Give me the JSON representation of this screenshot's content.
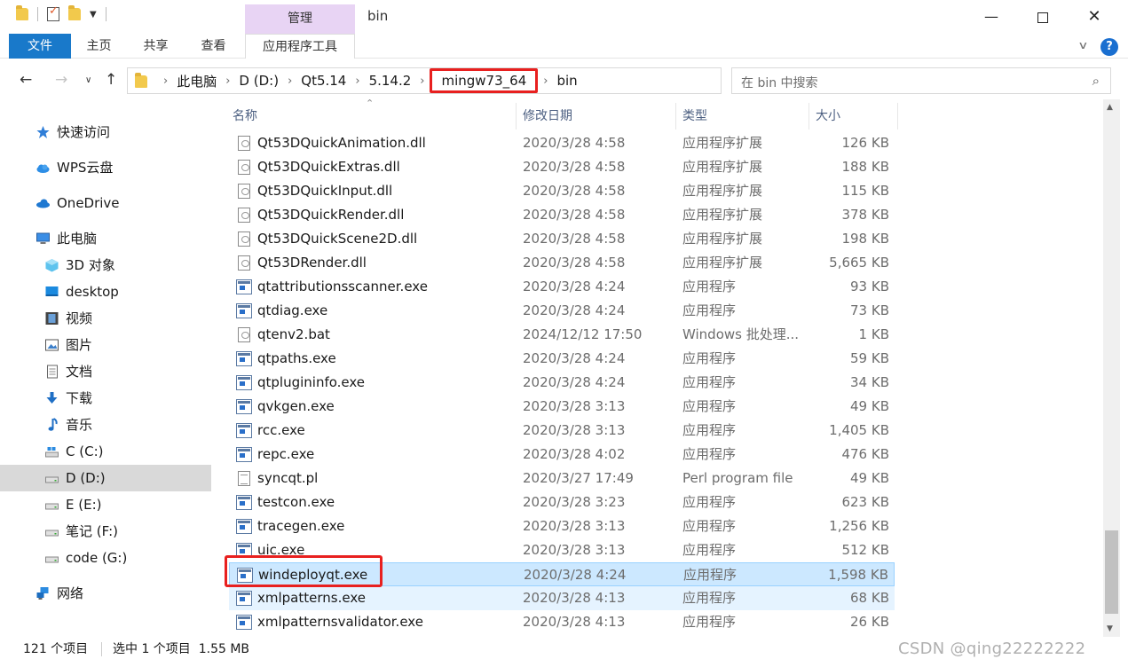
{
  "window": {
    "title": "bin",
    "context_tab_header": "管理",
    "buttons": {
      "minimize": "—",
      "maximize": "",
      "close": "✕"
    }
  },
  "ribbon": {
    "tabs": [
      "文件",
      "主页",
      "共享",
      "查看",
      "应用程序工具"
    ],
    "active_tab": "文件",
    "help": "?"
  },
  "address": {
    "crumbs": [
      "此电脑",
      "D (D:)",
      "Qt5.14",
      "5.14.2",
      "mingw73_64",
      "bin"
    ],
    "highlighted_crumb": "mingw73_64"
  },
  "search": {
    "placeholder": "在 bin 中搜索"
  },
  "nav_pane": {
    "items": [
      {
        "label": "快速访问",
        "icon": "star-icon"
      },
      {
        "label": "WPS云盘",
        "icon": "cloud-icon"
      },
      {
        "label": "OneDrive",
        "icon": "onedrive-icon"
      },
      {
        "label": "此电脑",
        "icon": "computer-icon"
      },
      {
        "label": "3D 对象",
        "icon": "cube-icon"
      },
      {
        "label": "desktop",
        "icon": "desktop-icon"
      },
      {
        "label": "视频",
        "icon": "video-icon"
      },
      {
        "label": "图片",
        "icon": "picture-icon"
      },
      {
        "label": "文档",
        "icon": "document-icon"
      },
      {
        "label": "下载",
        "icon": "download-icon"
      },
      {
        "label": "音乐",
        "icon": "music-icon"
      },
      {
        "label": "C (C:)",
        "icon": "drive-c-icon"
      },
      {
        "label": "D (D:)",
        "icon": "drive-icon"
      },
      {
        "label": "E (E:)",
        "icon": "drive-icon"
      },
      {
        "label": "笔记 (F:)",
        "icon": "drive-icon"
      },
      {
        "label": "code (G:)",
        "icon": "drive-icon"
      },
      {
        "label": "网络",
        "icon": "network-icon"
      }
    ],
    "selected": "D (D:)"
  },
  "columns": [
    "名称",
    "修改日期",
    "类型",
    "大小"
  ],
  "files": [
    {
      "name": "Qt53DQuickAnimation.dll",
      "date": "2020/3/28 4:58",
      "type": "应用程序扩展",
      "size": "126 KB",
      "icon": "dll"
    },
    {
      "name": "Qt53DQuickExtras.dll",
      "date": "2020/3/28 4:58",
      "type": "应用程序扩展",
      "size": "188 KB",
      "icon": "dll"
    },
    {
      "name": "Qt53DQuickInput.dll",
      "date": "2020/3/28 4:58",
      "type": "应用程序扩展",
      "size": "115 KB",
      "icon": "dll"
    },
    {
      "name": "Qt53DQuickRender.dll",
      "date": "2020/3/28 4:58",
      "type": "应用程序扩展",
      "size": "378 KB",
      "icon": "dll"
    },
    {
      "name": "Qt53DQuickScene2D.dll",
      "date": "2020/3/28 4:58",
      "type": "应用程序扩展",
      "size": "198 KB",
      "icon": "dll"
    },
    {
      "name": "Qt53DRender.dll",
      "date": "2020/3/28 4:58",
      "type": "应用程序扩展",
      "size": "5,665 KB",
      "icon": "dll"
    },
    {
      "name": "qtattributionsscanner.exe",
      "date": "2020/3/28 4:24",
      "type": "应用程序",
      "size": "93 KB",
      "icon": "exe"
    },
    {
      "name": "qtdiag.exe",
      "date": "2020/3/28 4:24",
      "type": "应用程序",
      "size": "73 KB",
      "icon": "exe"
    },
    {
      "name": "qtenv2.bat",
      "date": "2024/12/12 17:50",
      "type": "Windows 批处理...",
      "size": "1 KB",
      "icon": "bat"
    },
    {
      "name": "qtpaths.exe",
      "date": "2020/3/28 4:24",
      "type": "应用程序",
      "size": "59 KB",
      "icon": "exe"
    },
    {
      "name": "qtplugininfo.exe",
      "date": "2020/3/28 4:24",
      "type": "应用程序",
      "size": "34 KB",
      "icon": "exe"
    },
    {
      "name": "qvkgen.exe",
      "date": "2020/3/28 3:13",
      "type": "应用程序",
      "size": "49 KB",
      "icon": "exe"
    },
    {
      "name": "rcc.exe",
      "date": "2020/3/28 3:13",
      "type": "应用程序",
      "size": "1,405 KB",
      "icon": "exe"
    },
    {
      "name": "repc.exe",
      "date": "2020/3/28 4:02",
      "type": "应用程序",
      "size": "476 KB",
      "icon": "exe"
    },
    {
      "name": "syncqt.pl",
      "date": "2020/3/27 17:49",
      "type": "Perl program file",
      "size": "49 KB",
      "icon": "txt"
    },
    {
      "name": "testcon.exe",
      "date": "2020/3/28 3:23",
      "type": "应用程序",
      "size": "623 KB",
      "icon": "exe"
    },
    {
      "name": "tracegen.exe",
      "date": "2020/3/28 3:13",
      "type": "应用程序",
      "size": "1,256 KB",
      "icon": "exe"
    },
    {
      "name": "uic.exe",
      "date": "2020/3/28 3:13",
      "type": "应用程序",
      "size": "512 KB",
      "icon": "exe"
    },
    {
      "name": "windeployqt.exe",
      "date": "2020/3/28 4:24",
      "type": "应用程序",
      "size": "1,598 KB",
      "icon": "exe",
      "state": "selected"
    },
    {
      "name": "xmlpatterns.exe",
      "date": "2020/3/28 4:13",
      "type": "应用程序",
      "size": "68 KB",
      "icon": "exe",
      "state": "hover"
    },
    {
      "name": "xmlpatternsvalidator.exe",
      "date": "2020/3/28 4:13",
      "type": "应用程序",
      "size": "26 KB",
      "icon": "exe"
    }
  ],
  "status": {
    "count": "121 个项目",
    "selection": "选中 1 个项目  1.55 MB"
  },
  "watermark": "CSDN @qing22222222",
  "colors": {
    "accent": "#1979ca",
    "highlight_box": "#e8201f",
    "selected_row": "#cce8ff",
    "context_tab": "#e8d4f4"
  }
}
